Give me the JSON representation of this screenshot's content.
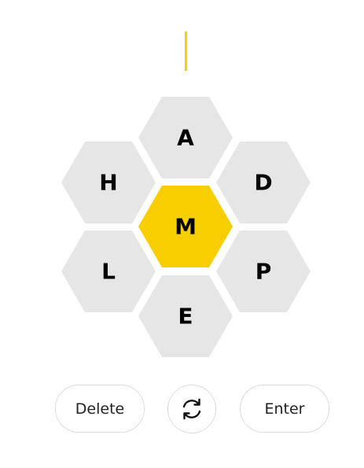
{
  "game": {
    "input_text": "",
    "accent_color": "#f7cf00",
    "outer_color": "#e6e6e6",
    "center_letter": "M",
    "outer_letters": [
      "A",
      "D",
      "P",
      "E",
      "L",
      "H"
    ]
  },
  "controls": {
    "delete_label": "Delete",
    "shuffle_icon": "shuffle-icon",
    "enter_label": "Enter"
  }
}
